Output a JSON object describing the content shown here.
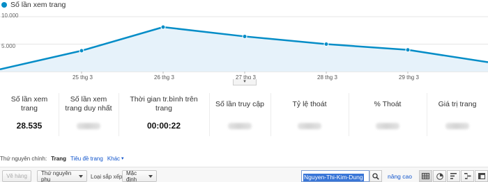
{
  "chart_data": {
    "type": "area",
    "series": [
      {
        "name": "Số lần xem trang",
        "values": [
          400,
          3800,
          8100,
          6400,
          5000,
          3950,
          1700
        ]
      }
    ],
    "x": [
      "",
      "25 thg 3",
      "26 thg 3",
      "27 thg 3",
      "28 thg 3",
      "29 thg 3",
      ""
    ],
    "y_ticks": [
      "10.000",
      "5.000"
    ],
    "ylim": [
      0,
      10000
    ],
    "color": "#058dc7",
    "fill": "#e6f2fa"
  },
  "legend_label": "Số lần xem trang",
  "metrics": [
    {
      "label": "Số lần xem trang",
      "value": "28.535",
      "blurred": false
    },
    {
      "label": "Số lần xem trang duy nhất",
      "value": "",
      "blurred": true
    },
    {
      "label": "Thời gian tr.bình trên trang",
      "value": "00:00:22",
      "blurred": false
    },
    {
      "label": "Số lần truy cập",
      "value": "",
      "blurred": true
    },
    {
      "label": "Tỷ lệ thoát",
      "value": "",
      "blurred": true
    },
    {
      "label": "% Thoát",
      "value": "",
      "blurred": true
    },
    {
      "label": "Giá trị trang",
      "value": "",
      "blurred": true
    }
  ],
  "dimension": {
    "label": "Thứ nguyên chính:",
    "active": "Trang",
    "alt": "Tiêu đề trang",
    "other": "Khác"
  },
  "toolbar": {
    "compare_label": "Vẽ hàng",
    "secondary_dim": "Thứ nguyên phụ",
    "sort_label": "Loại sắp xếp:",
    "sort_value": "Mặc định",
    "search_value": "Nguyen-Thi-Kim-Dung",
    "advanced": "nâng cao"
  }
}
